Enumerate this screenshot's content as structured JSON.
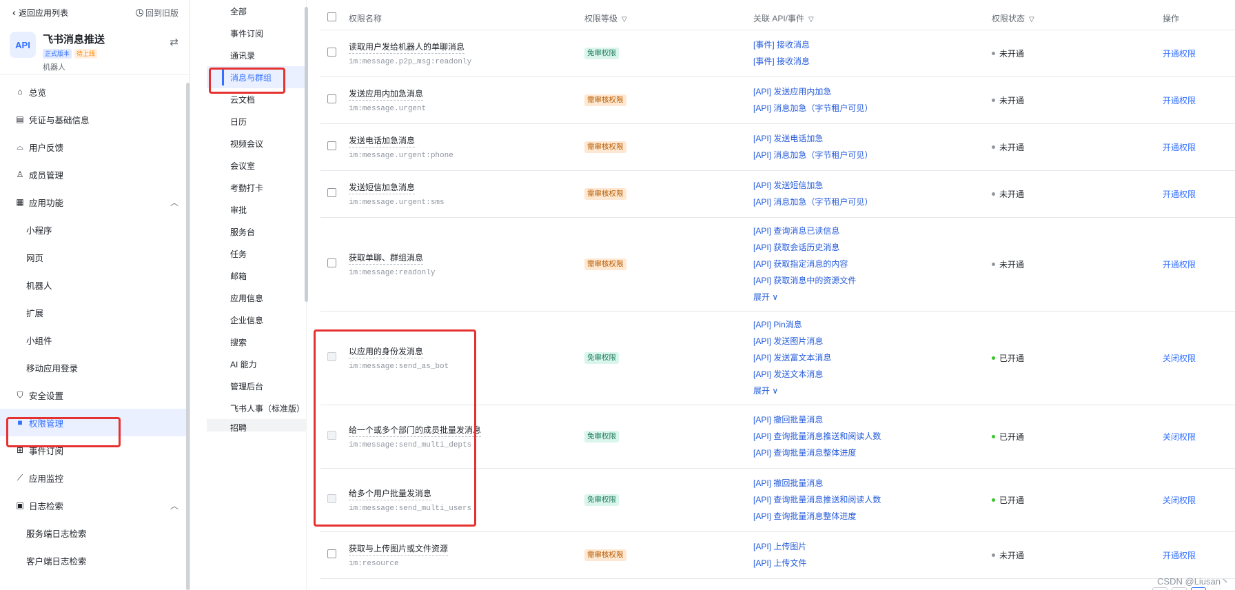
{
  "sidebar": {
    "back_label": "返回应用列表",
    "old_version_label": "回到旧版",
    "app": {
      "logo_text": "API",
      "name": "飞书消息推送",
      "tag_version": "正式版本",
      "tag_status": "待上线",
      "type": "机器人"
    },
    "items": [
      {
        "label": "总览",
        "icon": "home-icon",
        "glyph": "⌂"
      },
      {
        "label": "凭证与基础信息",
        "icon": "id-card-icon",
        "glyph": "▤"
      },
      {
        "label": "用户反馈",
        "icon": "inbox-icon",
        "glyph": "⌓"
      },
      {
        "label": "成员管理",
        "icon": "user-icon",
        "glyph": "♙"
      },
      {
        "label": "应用功能",
        "icon": "grid-icon",
        "glyph": "▦",
        "chevron": "︿"
      },
      {
        "label": "小程序",
        "sub": true
      },
      {
        "label": "网页",
        "sub": true
      },
      {
        "label": "机器人",
        "sub": true
      },
      {
        "label": "扩展",
        "sub": true
      },
      {
        "label": "小组件",
        "sub": true
      },
      {
        "label": "移动应用登录",
        "sub": true
      },
      {
        "label": "安全设置",
        "icon": "shield-icon",
        "glyph": "⛉"
      },
      {
        "label": "权限管理",
        "icon": "lock-icon",
        "glyph": "■",
        "active": true
      },
      {
        "label": "事件订阅",
        "icon": "event-icon",
        "glyph": "⊞"
      },
      {
        "label": "应用监控",
        "icon": "chart-icon",
        "glyph": "⟋"
      },
      {
        "label": "日志检索",
        "icon": "log-icon",
        "glyph": "▣",
        "chevron": "︿"
      },
      {
        "label": "服务端日志检索",
        "sub": true
      },
      {
        "label": "客户端日志检索",
        "sub": true
      }
    ]
  },
  "categories": [
    "全部",
    "事件订阅",
    "通讯录",
    "消息与群组",
    "云文档",
    "日历",
    "视频会议",
    "会议室",
    "考勤打卡",
    "审批",
    "服务台",
    "任务",
    "邮箱",
    "应用信息",
    "企业信息",
    "搜索",
    "AI 能力",
    "管理后台",
    "飞书人事（标准版）",
    "招聘"
  ],
  "active_category": "消息与群组",
  "table": {
    "headers": {
      "name": "权限名称",
      "level": "权限等级",
      "api": "关联 API/事件",
      "status": "权限状态",
      "action": "操作"
    },
    "rows": [
      {
        "title": "读取用户发给机器人的单聊消息",
        "code": "im:message.p2p_msg:readonly",
        "level": "免审权限",
        "level_kind": "free",
        "apis": [
          "[事件] 接收消息",
          "[事件] 接收消息"
        ],
        "status": "未开通",
        "status_kind": "off",
        "action": "开通权限"
      },
      {
        "title": "发送应用内加急消息",
        "code": "im:message.urgent",
        "level": "需审核权限",
        "level_kind": "audit",
        "apis": [
          "[API] 发送应用内加急",
          "[API] 消息加急（字节租户可见）"
        ],
        "status": "未开通",
        "status_kind": "off",
        "action": "开通权限"
      },
      {
        "title": "发送电话加急消息",
        "code": "im:message.urgent:phone",
        "level": "需审核权限",
        "level_kind": "audit",
        "apis": [
          "[API] 发送电话加急",
          "[API] 消息加急（字节租户可见）"
        ],
        "status": "未开通",
        "status_kind": "off",
        "action": "开通权限"
      },
      {
        "title": "发送短信加急消息",
        "code": "im:message.urgent:sms",
        "level": "需审核权限",
        "level_kind": "audit",
        "apis": [
          "[API] 发送短信加急",
          "[API] 消息加急（字节租户可见）"
        ],
        "status": "未开通",
        "status_kind": "off",
        "action": "开通权限"
      },
      {
        "title": "获取单聊、群组消息",
        "code": "im:message:readonly",
        "level": "需审核权限",
        "level_kind": "audit",
        "apis": [
          "[API] 查询消息已读信息",
          "[API] 获取会话历史消息",
          "[API] 获取指定消息的内容",
          "[API] 获取消息中的资源文件"
        ],
        "expand": "展开 ∨",
        "status": "未开通",
        "status_kind": "off",
        "action": "开通权限"
      },
      {
        "title": "以应用的身份发消息",
        "code": "im:message:send_as_bot",
        "level": "免审权限",
        "level_kind": "free",
        "apis": [
          "[API] Pin消息",
          "[API] 发送图片消息",
          "[API] 发送富文本消息",
          "[API] 发送文本消息"
        ],
        "expand": "展开 ∨",
        "status": "已开通",
        "status_kind": "on",
        "action": "关闭权限",
        "disabled": true
      },
      {
        "title": "给一个或多个部门的成员批量发消息",
        "code": "im:message:send_multi_depts",
        "level": "免审权限",
        "level_kind": "free",
        "apis": [
          "[API] 撤回批量消息",
          "[API] 查询批量消息推送和阅读人数",
          "[API] 查询批量消息整体进度"
        ],
        "status": "已开通",
        "status_kind": "on",
        "action": "关闭权限",
        "disabled": true
      },
      {
        "title": "给多个用户批量发消息",
        "code": "im:message:send_multi_users",
        "level": "免审权限",
        "level_kind": "free",
        "apis": [
          "[API] 撤回批量消息",
          "[API] 查询批量消息推送和阅读人数",
          "[API] 查询批量消息整体进度"
        ],
        "status": "已开通",
        "status_kind": "on",
        "action": "关闭权限",
        "disabled": true
      },
      {
        "title": "获取与上传图片或文件资源",
        "code": "im:resource",
        "level": "需审核权限",
        "level_kind": "audit",
        "apis": [
          "[API] 上传图片",
          "[API] 上传文件"
        ],
        "status": "未开通",
        "status_kind": "off",
        "action": "开通权限"
      }
    ]
  },
  "watermark": "CSDN @Liusan丶",
  "colors": {
    "accent": "#3370ff",
    "highlight": "#e5312f",
    "on": "#34c724",
    "off": "#8f959e"
  }
}
